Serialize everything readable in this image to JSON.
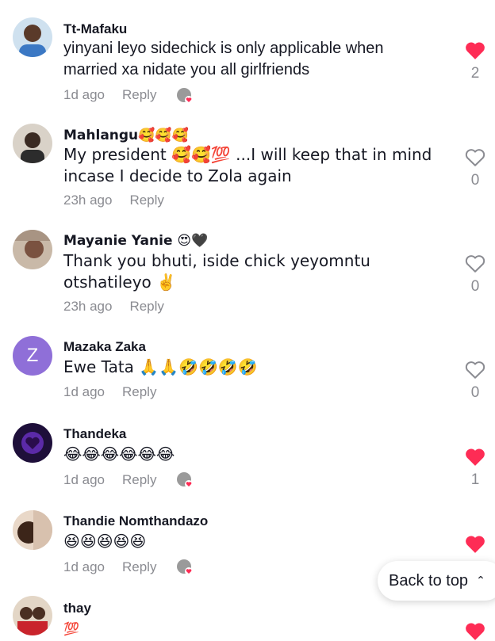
{
  "comments": [
    {
      "name": "Tt-Mafaku",
      "text": "yinyani leyo sidechick is only applicable when married xa nidate you all girlfriends",
      "time": "1d ago",
      "reply": "Reply",
      "likes": "2",
      "liked": true
    },
    {
      "name": "Mahlangu🥰🥰🥰",
      "text": "My president 🥰🥰💯 ...I will keep that in mind incase I decide to Zola again",
      "time": "23h ago",
      "reply": "Reply",
      "likes": "0",
      "liked": false
    },
    {
      "name": "Mayanie Yanie 😍🖤",
      "text": "Thank you bhuti, iside chick yeyomntu otshatileyo ✌️",
      "time": "23h ago",
      "reply": "Reply",
      "likes": "0",
      "liked": false
    },
    {
      "name": "Mazaka Zaka",
      "avatar_letter": "Z",
      "text": "Ewe Tata 🙏🙏🤣🤣🤣🤣",
      "time": "1d ago",
      "reply": "Reply",
      "likes": "0",
      "liked": false
    },
    {
      "name": "Thandeka",
      "text": "😂😂😂😂😂😂",
      "time": "1d ago",
      "reply": "Reply",
      "likes": "1",
      "liked": true
    },
    {
      "name": "Thandie Nomthandazo",
      "text": "😆😆😆😆😆",
      "time": "1d ago",
      "reply": "Reply",
      "likes": "",
      "liked": true
    },
    {
      "name": "thay",
      "text": "💯",
      "time": "",
      "reply": "",
      "likes": "",
      "liked": true
    }
  ],
  "back_to_top": "Back to top",
  "colors": {
    "like_active": "#FE2C55",
    "like_inactive": "#8a8b91",
    "avatar_letter_bg": "#8F6FD8"
  }
}
